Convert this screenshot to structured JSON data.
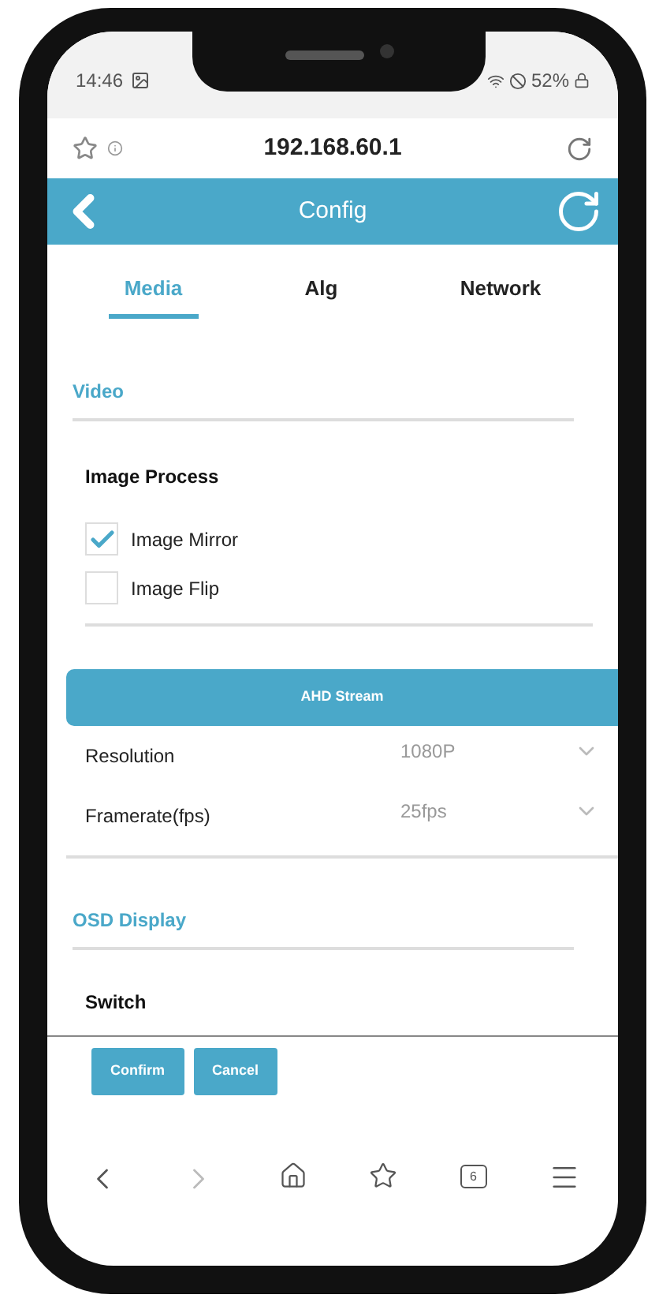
{
  "status_bar": {
    "time": "14:46",
    "battery": "52%"
  },
  "browser": {
    "url": "192.168.60.1"
  },
  "header": {
    "title": "Config"
  },
  "tabs": [
    {
      "label": "Media",
      "selected": true
    },
    {
      "label": "Alg",
      "selected": false
    },
    {
      "label": "Network",
      "selected": false
    }
  ],
  "video": {
    "title": "Video",
    "group_title": "Image Process",
    "options": [
      {
        "label": "Image Mirror",
        "checked": true
      },
      {
        "label": "Image Flip",
        "checked": false
      }
    ]
  },
  "stream": {
    "title": "AHD Stream",
    "fields": [
      {
        "label": "Resolution",
        "value": "1080P"
      },
      {
        "label": "Framerate(fps)",
        "value": "25fps"
      }
    ]
  },
  "osd": {
    "title": "OSD Display",
    "group_title": "Switch"
  },
  "buttons": [
    "Confirm",
    "Cancel"
  ],
  "bottom_nav": {
    "tab_count": "6"
  }
}
